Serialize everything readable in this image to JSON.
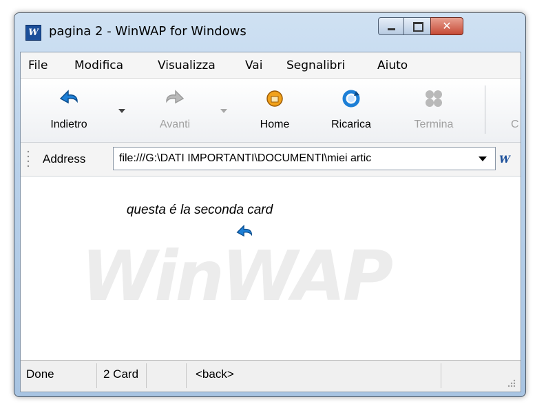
{
  "window": {
    "title": "pagina 2 - WinWAP for Windows",
    "icon_letter": "W",
    "controls": {
      "minimize": "minimize-icon",
      "maximize": "maximize-icon",
      "close": "✕"
    }
  },
  "menu": [
    "File",
    "Modifica",
    "Visualizza",
    "Vai",
    "Segnalibri",
    "Aiuto"
  ],
  "toolbar": {
    "back": {
      "label": "Indietro",
      "icon": "back-arrow-icon",
      "enabled": true
    },
    "forward": {
      "label": "Avanti",
      "icon": "forward-arrow-icon",
      "enabled": false
    },
    "home": {
      "label": "Home",
      "icon": "home-icon",
      "enabled": true
    },
    "reload": {
      "label": "Ricarica",
      "icon": "reload-icon",
      "enabled": true
    },
    "stop": {
      "label": "Termina",
      "icon": "stop-icon",
      "enabled": false
    },
    "overflow": {
      "label": "C"
    }
  },
  "address": {
    "label": "Address",
    "value": "file:///G:\\DATI IMPORTANTI\\DOCUMENTI\\miei artic"
  },
  "content": {
    "card_text": "questa é la seconda card",
    "watermark": "WinWAP"
  },
  "status": {
    "state": "Done",
    "cards": "2 Card",
    "link": "<back>"
  },
  "colors": {
    "accent": "#1d7fd6",
    "title_bar": "#c4d8ee",
    "close_button": "#c64a36"
  }
}
